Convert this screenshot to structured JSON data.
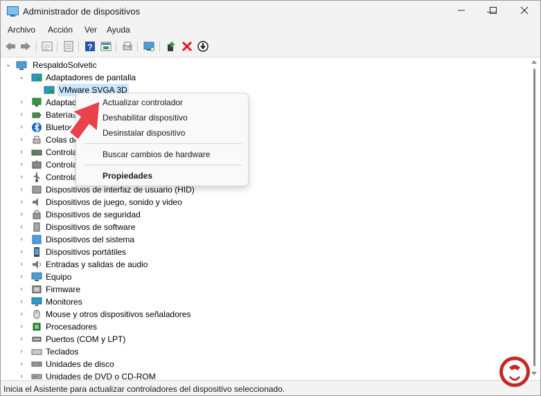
{
  "window": {
    "title": "Administrador de dispositivos",
    "controls": [
      "minimize",
      "maximize",
      "close"
    ]
  },
  "menubar": [
    {
      "label": "Archivo"
    },
    {
      "label": "Acción"
    },
    {
      "label": "Ver"
    },
    {
      "label": "Ayuda"
    }
  ],
  "toolbar": [
    {
      "icon": "back-arrow-icon"
    },
    {
      "icon": "forward-arrow-icon"
    },
    {
      "icon": "properties-icon"
    },
    {
      "icon": "list-view-icon"
    },
    {
      "icon": "help-icon"
    },
    {
      "icon": "view-icon"
    },
    {
      "icon": "printer-icon"
    },
    {
      "icon": "monitor-scan-icon"
    },
    {
      "icon": "update-driver-icon"
    },
    {
      "icon": "uninstall-x-icon"
    },
    {
      "icon": "download-circle-icon"
    }
  ],
  "tree": {
    "root": "RespaldoSolvetic",
    "expanded_category": "Adaptadores de pantalla",
    "selected_device": "VMware SVGA 3D",
    "categories": [
      {
        "label": "Adaptad",
        "icon": "network-adapter-icon"
      },
      {
        "label": "Baterías",
        "icon": "battery-icon"
      },
      {
        "label": "Bluetoo",
        "icon": "bluetooth-icon"
      },
      {
        "label": "Colas de",
        "icon": "print-queue-icon"
      },
      {
        "label": "Controla",
        "icon": "storage-controller-icon"
      },
      {
        "label": "Controla",
        "icon": "bus-controller-icon"
      },
      {
        "label": "Controla",
        "icon": "usb-controller-icon"
      },
      {
        "label": "Dispositivos de interfaz de usuario (HID)",
        "icon": "hid-icon"
      },
      {
        "label": "Dispositivos de juego, sonido y video",
        "icon": "speaker-icon"
      },
      {
        "label": "Dispositivos de seguridad",
        "icon": "security-device-icon"
      },
      {
        "label": "Dispositivos de software",
        "icon": "software-device-icon"
      },
      {
        "label": "Dispositivos del sistema",
        "icon": "system-device-icon"
      },
      {
        "label": "Dispositivos portátiles",
        "icon": "portable-device-icon"
      },
      {
        "label": "Entradas y salidas de audio",
        "icon": "audio-io-icon"
      },
      {
        "label": "Equipo",
        "icon": "computer-icon"
      },
      {
        "label": "Firmware",
        "icon": "firmware-icon"
      },
      {
        "label": "Monitores",
        "icon": "monitor-icon"
      },
      {
        "label": "Mouse y otros dispositivos señaladores",
        "icon": "mouse-icon"
      },
      {
        "label": "Procesadores",
        "icon": "processor-icon"
      },
      {
        "label": "Puertos (COM y LPT)",
        "icon": "port-icon"
      },
      {
        "label": "Teclados",
        "icon": "keyboard-icon"
      },
      {
        "label": "Unidades de disco",
        "icon": "disk-drive-icon"
      },
      {
        "label": "Unidades de DVD o CD-ROM",
        "icon": "dvd-drive-icon"
      }
    ]
  },
  "context_menu": {
    "items": [
      {
        "label": "Actualizar controlador",
        "bold": false
      },
      {
        "label": "Deshabilitar dispositivo",
        "bold": false
      },
      {
        "label": "Desinstalar dispositivo",
        "bold": false
      },
      {
        "label": "Buscar cambios de hardware",
        "bold": false
      },
      {
        "label": "Propiedades",
        "bold": true
      }
    ]
  },
  "statusbar": {
    "text": "Inicia el Asistente para actualizar controladores del dispositivo seleccionado."
  },
  "colors": {
    "selection": "#cce8ff",
    "arrow": "#e8434a",
    "logo": "#c62828",
    "accent_green": "#2e9a3a",
    "accent_red": "#e81123"
  }
}
